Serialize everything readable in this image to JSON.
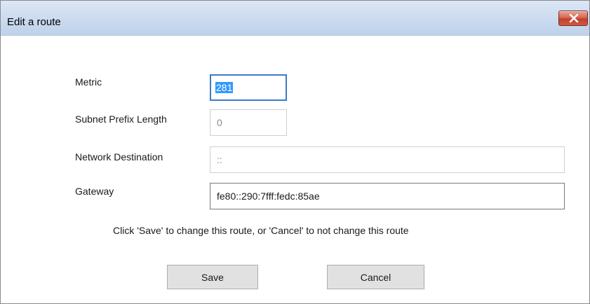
{
  "window": {
    "title": "Edit a route",
    "close_icon": "close-x-icon"
  },
  "form": {
    "metric": {
      "label": "Metric",
      "value": "281"
    },
    "subnet_prefix_length": {
      "label": "Subnet Prefix Length",
      "value": "0"
    },
    "network_destination": {
      "label": "Network Destination",
      "value": "::"
    },
    "gateway": {
      "label": "Gateway",
      "value": "fe80::290:7fff:fedc:85ae"
    }
  },
  "hint": "Click 'Save' to change this route, or 'Cancel' to not change this route",
  "buttons": {
    "save": "Save",
    "cancel": "Cancel"
  },
  "colors": {
    "selection": "#3399ff",
    "focus_border": "#3d7bc8",
    "close_button": "#c2412b"
  }
}
